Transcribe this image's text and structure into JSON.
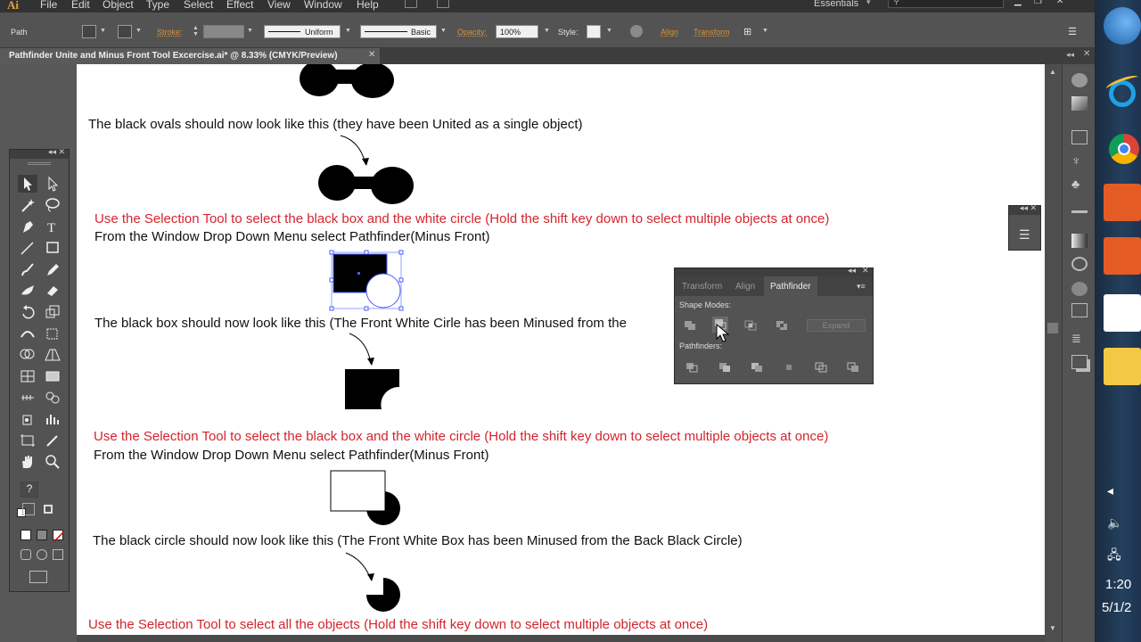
{
  "menubar": {
    "logo": "Ai",
    "items": [
      "File",
      "Edit",
      "Object",
      "Type",
      "Select",
      "Effect",
      "View",
      "Window",
      "Help"
    ],
    "workspace": "Essentials"
  },
  "control": {
    "selection": "Path",
    "stroke_label": "Stroke:",
    "profile": "Uniform",
    "brush": "Basic",
    "opacity_label": "Opacity:",
    "opacity": "100%",
    "style_label": "Style:",
    "align": "Align",
    "transform": "Transform"
  },
  "document": {
    "tab_title": "Pathfinder Unite and Minus Front Tool Excercise.ai* @ 8.33% (CMYK/Preview)",
    "close": "✕"
  },
  "artboard": {
    "line1": "The black ovals should now look like this (they have been United as a single object)",
    "line2": "Use the Selection Tool to select the black box and the white circle (Hold the shift key down  to select multiple objects at once)",
    "line3": "From the Window Drop Down Menu select Pathfinder(Minus Front)",
    "line4": "The black box should now look like this (The Front White Cirle has been Minused from the",
    "line5": "Use the Selection Tool to select the black box and the white circle (Hold the shift key down  to select multiple objects at once)",
    "line6": "From the Window Drop Down Menu select Pathfinder(Minus Front)",
    "line7": "The black circle should now look like this (The Front White Box has been Minused from the Back Black Circle)",
    "line8": "Use the Selection Tool to select all the objects (Hold the shift key down  to select multiple objects at once)"
  },
  "pathfinder_panel": {
    "tabs": [
      "Transform",
      "Align",
      "Pathfinder"
    ],
    "active_tab": "Pathfinder",
    "shape_modes": "Shape Modes:",
    "pathfinders": "Pathfinders:",
    "expand": "Expand"
  },
  "taskbar": {
    "time": "1:20",
    "date": "5/1/2"
  },
  "colors": {
    "instruction_red": "#d4242c",
    "panel_gray": "#535353",
    "accent_orange": "#d8913a"
  }
}
